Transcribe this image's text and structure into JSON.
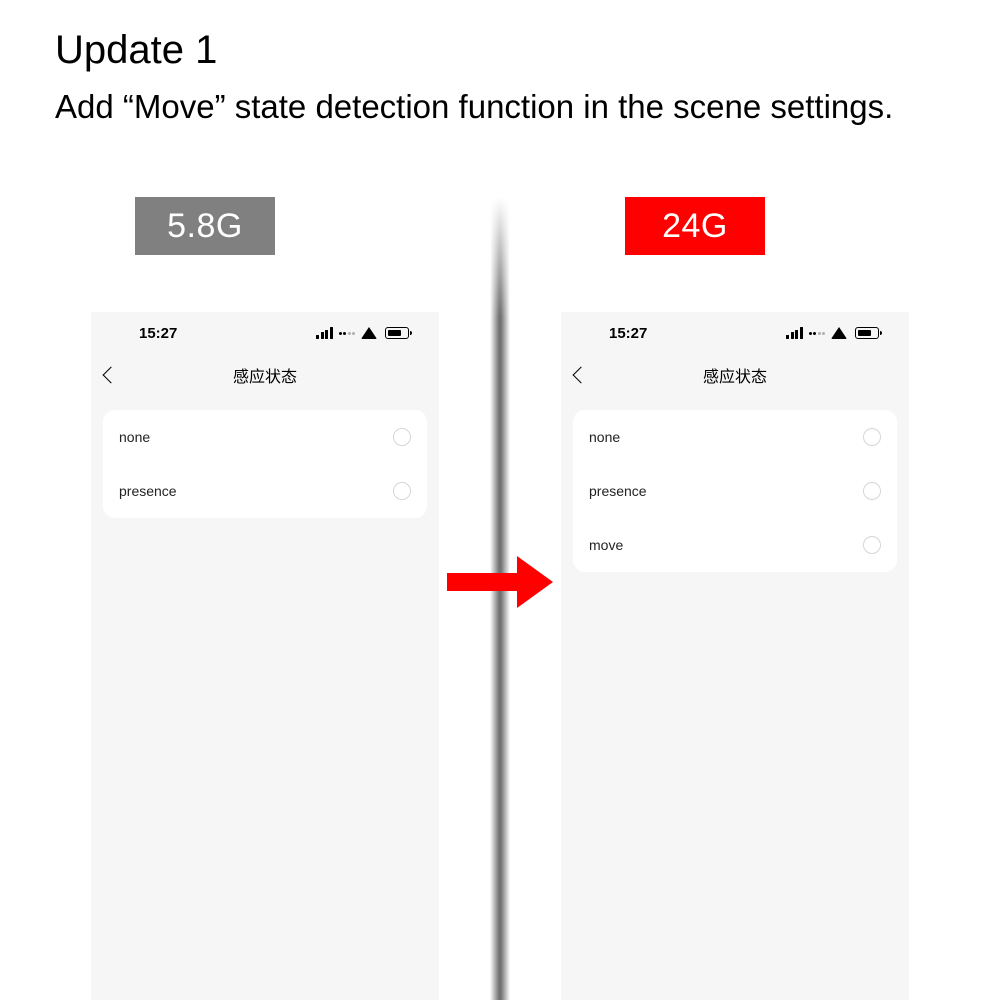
{
  "heading": {
    "title": "Update 1",
    "subtitle": "Add “Move”  state detection function in the scene settings."
  },
  "badges": {
    "left": "5.8G",
    "right": "24G"
  },
  "left_phone": {
    "time": "15:27",
    "nav_title": "感应状态",
    "rows": [
      "none",
      "presence"
    ]
  },
  "right_phone": {
    "time": "15:27",
    "nav_title": "感应状态",
    "rows": [
      "none",
      "presence",
      "move"
    ]
  }
}
